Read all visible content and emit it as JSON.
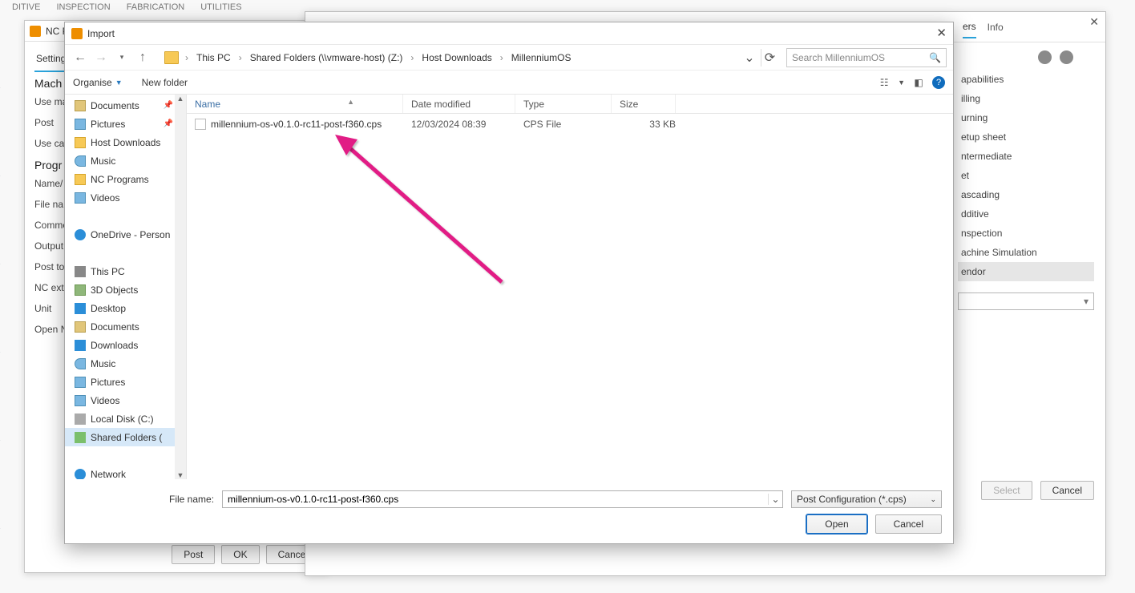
{
  "fusion_tabs": [
    "DITIVE",
    "INSPECTION",
    "FABRICATION",
    "UTILITIES"
  ],
  "nc_panel": {
    "title": "NC P",
    "settings_tab": "Settings",
    "section_machine": "Mach",
    "section_program": "Progr",
    "labels": {
      "use_ma": "Use ma",
      "post": "Post",
      "use_cas": "Use cas",
      "name": "Name/",
      "file_na": "File na",
      "commen": "Comme",
      "output": "Output",
      "post_to": "Post to",
      "nc_ext": "NC exte",
      "unit": "Unit",
      "open_n": "Open N"
    },
    "buttons": {
      "post": "Post",
      "ok": "OK",
      "cancel": "Cancel"
    }
  },
  "post_panel": {
    "tabs": {
      "parameters": "ers",
      "info": "Info"
    },
    "caps": "apabilities",
    "items": [
      "illing",
      "urning",
      "etup sheet",
      "ntermediate",
      "et",
      "ascading",
      "dditive",
      "nspection",
      "achine Simulation",
      "endor"
    ],
    "buttons": {
      "select": "Select",
      "cancel": "Cancel"
    }
  },
  "import": {
    "title": "Import",
    "crumbs": [
      "This PC",
      "Shared Folders (\\\\vmware-host) (Z:)",
      "Host Downloads",
      "MillenniumOS"
    ],
    "search_placeholder": "Search MillenniumOS",
    "organise": "Organise",
    "new_folder": "New folder",
    "columns": {
      "name": "Name",
      "date": "Date modified",
      "type": "Type",
      "size": "Size"
    },
    "tree": [
      {
        "label": "Documents",
        "icon": "doc",
        "pin": true
      },
      {
        "label": "Pictures",
        "icon": "pic",
        "pin": true
      },
      {
        "label": "Host Downloads",
        "icon": "fold"
      },
      {
        "label": "Music",
        "icon": "music"
      },
      {
        "label": "NC Programs",
        "icon": "fold"
      },
      {
        "label": "Videos",
        "icon": "vid"
      },
      {
        "label": "",
        "icon": ""
      },
      {
        "label": "OneDrive - Person",
        "icon": "cloud"
      },
      {
        "label": "",
        "icon": ""
      },
      {
        "label": "This PC",
        "icon": "pc"
      },
      {
        "label": "3D Objects",
        "icon": "3d"
      },
      {
        "label": "Desktop",
        "icon": "desk"
      },
      {
        "label": "Documents",
        "icon": "doc"
      },
      {
        "label": "Downloads",
        "icon": "dl"
      },
      {
        "label": "Music",
        "icon": "music"
      },
      {
        "label": "Pictures",
        "icon": "pic"
      },
      {
        "label": "Videos",
        "icon": "vid"
      },
      {
        "label": "Local Disk (C:)",
        "icon": "disk"
      },
      {
        "label": "Shared Folders (",
        "icon": "sf",
        "sel": true
      },
      {
        "label": "",
        "icon": ""
      },
      {
        "label": "Network",
        "icon": "net"
      }
    ],
    "files": [
      {
        "name": "millennium-os-v0.1.0-rc11-post-f360.cps",
        "date": "12/03/2024 08:39",
        "type": "CPS File",
        "size": "33 KB"
      }
    ],
    "filename_label": "File name:",
    "filename_value": "millennium-os-v0.1.0-rc11-post-f360.cps",
    "filter": "Post Configuration (*.cps)",
    "buttons": {
      "open": "Open",
      "cancel": "Cancel"
    }
  }
}
